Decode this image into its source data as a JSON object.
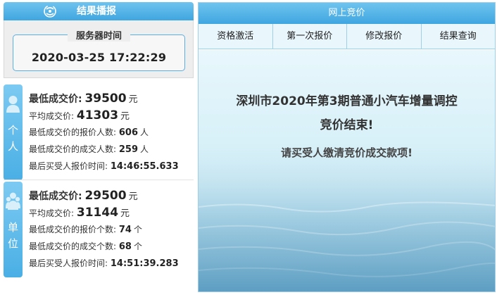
{
  "left_header": {
    "title": "结果播报",
    "logo_icon": "refresh-swirl-icon"
  },
  "server": {
    "label": "服务器时间",
    "time": "2020-03-25 17:22:29"
  },
  "personal": {
    "tab_label": "个\n人",
    "icon": "person-icon",
    "rows": {
      "lowest_price_label": "最低成交价:",
      "lowest_price_value": "39500",
      "lowest_price_unit": "元",
      "avg_price_label": "平均成交价:",
      "avg_price_value": "41303",
      "avg_price_unit": "元",
      "bidders_at_lowest_label": "最低成交价的报价人数:",
      "bidders_at_lowest_value": "606",
      "bidders_at_lowest_unit": "人",
      "deals_at_lowest_label": "最低成交价的成交人数:",
      "deals_at_lowest_value": "259",
      "deals_at_lowest_unit": "人",
      "last_bid_time_label": "最后买受人报价时间:",
      "last_bid_time_value": "14:46:55.633"
    }
  },
  "unit": {
    "tab_label": "单\n位",
    "icon": "group-icon",
    "rows": {
      "lowest_price_label": "最低成交价:",
      "lowest_price_value": "29500",
      "lowest_price_unit": "元",
      "avg_price_label": "平均成交价:",
      "avg_price_value": "31144",
      "avg_price_unit": "元",
      "bidders_at_lowest_label": "最低成交价的报价个数:",
      "bidders_at_lowest_value": "74",
      "bidders_at_lowest_unit": "个",
      "deals_at_lowest_label": "最低成交价的成交个数:",
      "deals_at_lowest_value": "68",
      "deals_at_lowest_unit": "个",
      "last_bid_time_label": "最后买受人报价时间:",
      "last_bid_time_value": "14:51:39.283"
    }
  },
  "right_header": {
    "title": "网上竞价"
  },
  "tabs": [
    {
      "label": "资格激活"
    },
    {
      "label": "第一次报价"
    },
    {
      "label": "修改报价"
    },
    {
      "label": "结果查询"
    }
  ],
  "message": {
    "line1": "深圳市2020年第3期普通小汽车增量调控",
    "line2": "竞价结束!",
    "line3": "请买受人缴清竞价成交款项!"
  },
  "colors": {
    "accent": "#4aafe5",
    "header_dark": "#3fa6e0",
    "tab_bg": "#e9f6fc"
  }
}
